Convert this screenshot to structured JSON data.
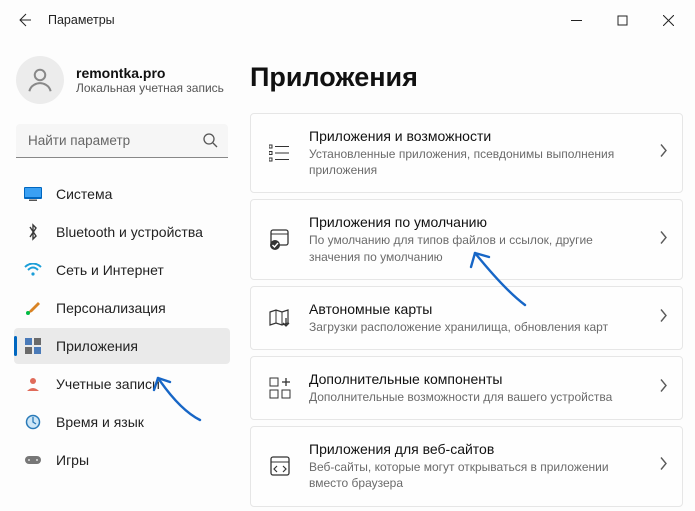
{
  "window": {
    "title": "Параметры"
  },
  "user": {
    "name": "remontka.pro",
    "subtitle": "Локальная учетная запись"
  },
  "search": {
    "placeholder": "Найти параметр"
  },
  "sidebar": {
    "items": [
      {
        "label": "Система"
      },
      {
        "label": "Bluetooth и устройства"
      },
      {
        "label": "Сеть и Интернет"
      },
      {
        "label": "Персонализация"
      },
      {
        "label": "Приложения"
      },
      {
        "label": "Учетные записи"
      },
      {
        "label": "Время и язык"
      },
      {
        "label": "Игры"
      }
    ]
  },
  "page": {
    "title": "Приложения"
  },
  "cards": [
    {
      "title": "Приложения и возможности",
      "sub": "Установленные приложения, псевдонимы выполнения приложения"
    },
    {
      "title": "Приложения по умолчанию",
      "sub": "По умолчанию для типов файлов и ссылок, другие значения по умолчанию"
    },
    {
      "title": "Автономные карты",
      "sub": "Загрузки расположение хранилища, обновления карт"
    },
    {
      "title": "Дополнительные компоненты",
      "sub": "Дополнительные возможности для вашего устройства"
    },
    {
      "title": "Приложения для веб-сайтов",
      "sub": "Веб-сайты, которые могут открываться в приложении вместо браузера"
    }
  ]
}
